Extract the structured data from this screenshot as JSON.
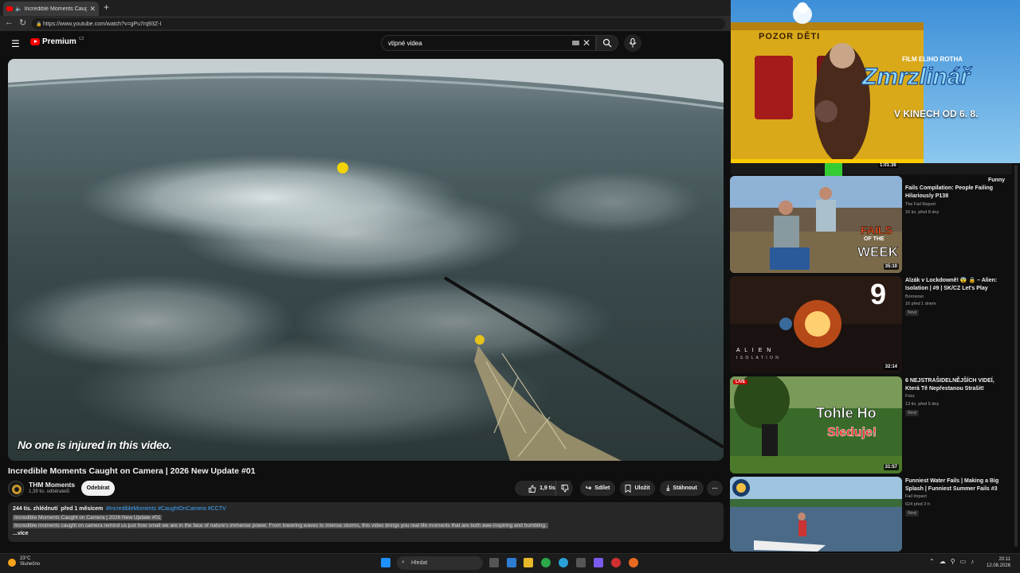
{
  "browser": {
    "tab_title": "Incredible Moments Caught o",
    "new_tab_symbol": "+",
    "url": "https://www.youtube.com/watch?v=gPu7rq93Z-I"
  },
  "header": {
    "logo_text": "Premium",
    "logo_superscript": "CZ",
    "search_value": "vtipné videa"
  },
  "video": {
    "caption": "No one is injured in this video.",
    "title": "Incredible Moments Caught on Camera | 2026 New Update #01",
    "channel": "THM Moments",
    "subscribers": "1,39 tis. odběratelů",
    "subscribe_label": "Odebírat",
    "likes": "1,9 tis.",
    "share_label": "Sdílet",
    "save_label": "Uložit",
    "download_label": "Stáhnout"
  },
  "description": {
    "views": "244 tis. zhlédnutí",
    "date": "před 1 měsícem",
    "hashtags": "#IncredibleMoments #CaughtOnCamera #CCTV",
    "line1": "Incredible Moments Caught on Camera | 2026 New Update #01",
    "line2": "Incredible moments caught on camera remind us just how small we are in the face of nature's immense power. From towering waves to intense storms, this video brings you real life moments that are both awe-inspiring and humbling.",
    "more": "...více"
  },
  "ad": {
    "warning_sign": "POZOR DĚTI",
    "kicker": "FILM ELIHO ROTHA",
    "title": "Zmrzlinář",
    "release": "V KINECH OD 6. 8."
  },
  "recommendations": [
    {
      "title": "Fails Compilation: People Failing Hilariously P138",
      "title_top": "Funny",
      "channel": "The Fail Report",
      "meta": "16 tis.  před 8 dny",
      "duration": "35:10",
      "thumb_text1": "FAILS",
      "thumb_text2": "OF THE",
      "thumb_text3": "WEEK",
      "partial_duration": "1:01:36"
    },
    {
      "title": "Alzák v Lockdowně! 😨 🔒 – Alien: Isolation | #9 | SK/CZ Let's Play",
      "channel": "Borosovo",
      "meta": "16  před 1 dnem",
      "badge": "Nový",
      "duration": "32:14",
      "number": "9",
      "thumb_text": "A L I E N",
      "thumb_text2": "I S O L A T I O N"
    },
    {
      "title": "6 NEJSTRAŠIDELNĚJŠÍCH VIDEÍ, Která Tě Nepřestanou Strašit!",
      "channel": "Frizz",
      "meta": "13 tis.  před 5 dny",
      "badge": "Nový",
      "duration": "31:57",
      "live": "LIVE",
      "thumb_text1": "Tohle Ho",
      "thumb_text2": "Sleduje!"
    },
    {
      "title": "Funniest Water Fails | Making a Big Splash | Funniest Summer Fails #3",
      "channel": "Fail Impact",
      "meta": "624  před 3 h",
      "badge": "Nový"
    }
  ],
  "taskbar": {
    "temperature": "23°C",
    "weather": "Slunečno",
    "search_label": "Hledat",
    "time": "20:11",
    "date": "12.08.2026"
  }
}
